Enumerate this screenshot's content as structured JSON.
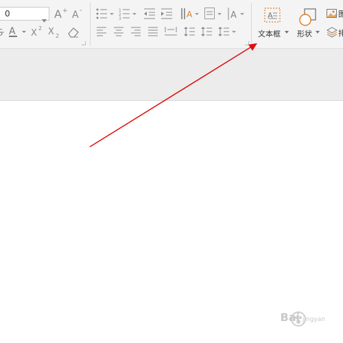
{
  "font_size": {
    "value": "0"
  },
  "insert_group": {
    "textbox_label": "文本框",
    "shape_label": "形状",
    "picture_label": "图",
    "arrange_label": "排"
  },
  "watermark": {
    "text": "Bai",
    "suffix": "jingyan"
  },
  "colors": {
    "accent_orange": "#e07b1f",
    "arrow_red": "#dd1111",
    "icon_gray": "#8a8a8a"
  }
}
